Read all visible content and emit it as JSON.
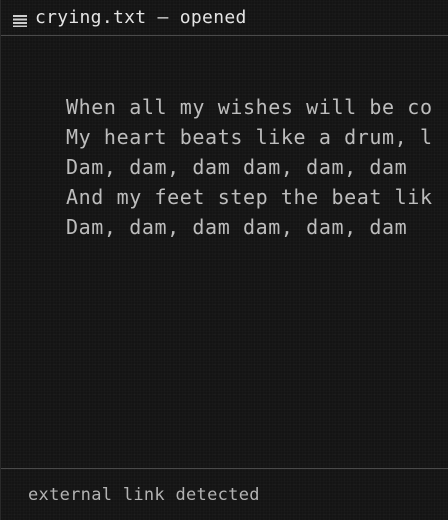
{
  "window": {
    "title": "crying.txt — opened",
    "icon": "file-lines-icon"
  },
  "editor": {
    "lines": [
      "When all my wishes will be co",
      "My heart beats like a drum, l",
      "Dam, dam, dam dam, dam, dam",
      "And my feet step the beat lik",
      "Dam, dam, dam dam, dam, dam"
    ]
  },
  "status": {
    "text": "external link detected"
  }
}
